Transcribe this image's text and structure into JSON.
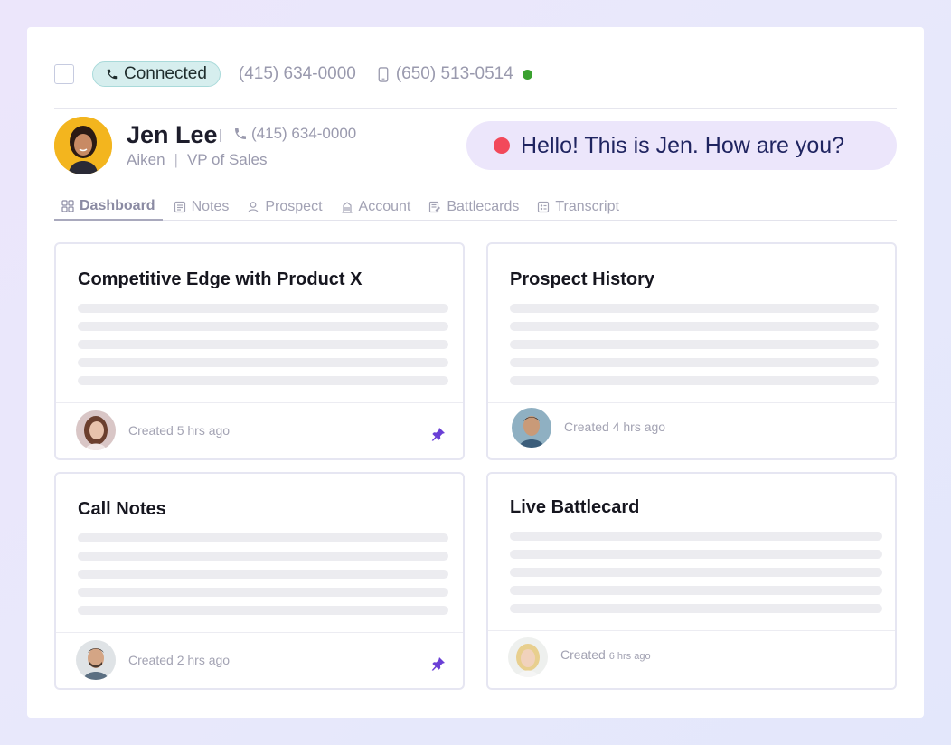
{
  "call": {
    "status_label": "Connected",
    "phone_primary": "(415) 634-0000",
    "phone_mobile": "(650) 513-0514",
    "online_color": "#3aa12f"
  },
  "contact": {
    "name": "Jen Lee",
    "phone": "(415) 634-0000",
    "company": "Aiken",
    "title": "VP of Sales"
  },
  "transcript_bubble": {
    "text": "Hello! This is Jen. How are you?",
    "recording_color": "#f2495a"
  },
  "tabs": [
    {
      "label": "Dashboard",
      "icon": "grid-icon",
      "active": true
    },
    {
      "label": "Notes",
      "icon": "document-icon",
      "active": false
    },
    {
      "label": "Prospect",
      "icon": "person-icon",
      "active": false
    },
    {
      "label": "Account",
      "icon": "building-icon",
      "active": false
    },
    {
      "label": "Battlecards",
      "icon": "battlecard-icon",
      "active": false
    },
    {
      "label": "Transcript",
      "icon": "transcript-icon",
      "active": false
    }
  ],
  "cards": [
    {
      "title": "Competitive Edge with Product X",
      "created": "Created 5 hrs ago",
      "pinned": true
    },
    {
      "title": "Prospect History",
      "created": "Created 4 hrs ago",
      "pinned": false
    },
    {
      "title": "Call Notes",
      "created": "Created 2 hrs ago",
      "pinned": true
    },
    {
      "title": "Live Battlecard",
      "created_prefix": "Created",
      "created_suffix": "6 hrs ago",
      "pinned": false
    }
  ],
  "colors": {
    "accent_purple": "#6a3fd6",
    "bubble_bg": "#ece6fb",
    "connected_bg": "#d6eeee"
  }
}
